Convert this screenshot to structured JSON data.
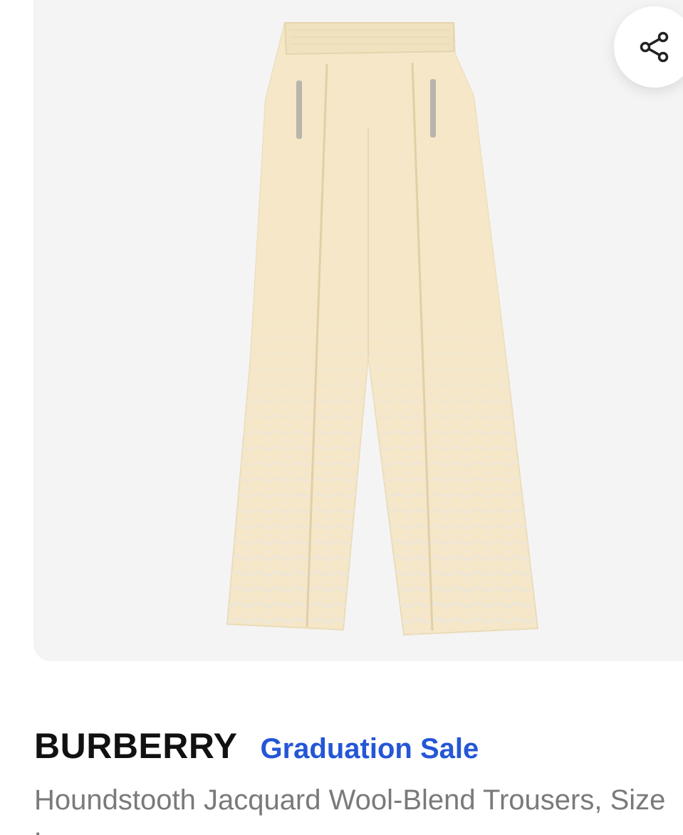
{
  "product": {
    "brand": "BURBERRY",
    "promo_label": "Graduation Sale",
    "description": "Houndstooth Jacquard Wool-Blend Trousers, Size Large",
    "image_alt": "Beige houndstooth jacquard wide-leg trousers"
  },
  "actions": {
    "share_icon": "share-icon"
  },
  "colors": {
    "brand_text": "#111111",
    "promo_link": "#2456d6",
    "description_text": "#7a7a7a",
    "image_background": "#f4f4f4",
    "garment": "#f5e7c7"
  }
}
